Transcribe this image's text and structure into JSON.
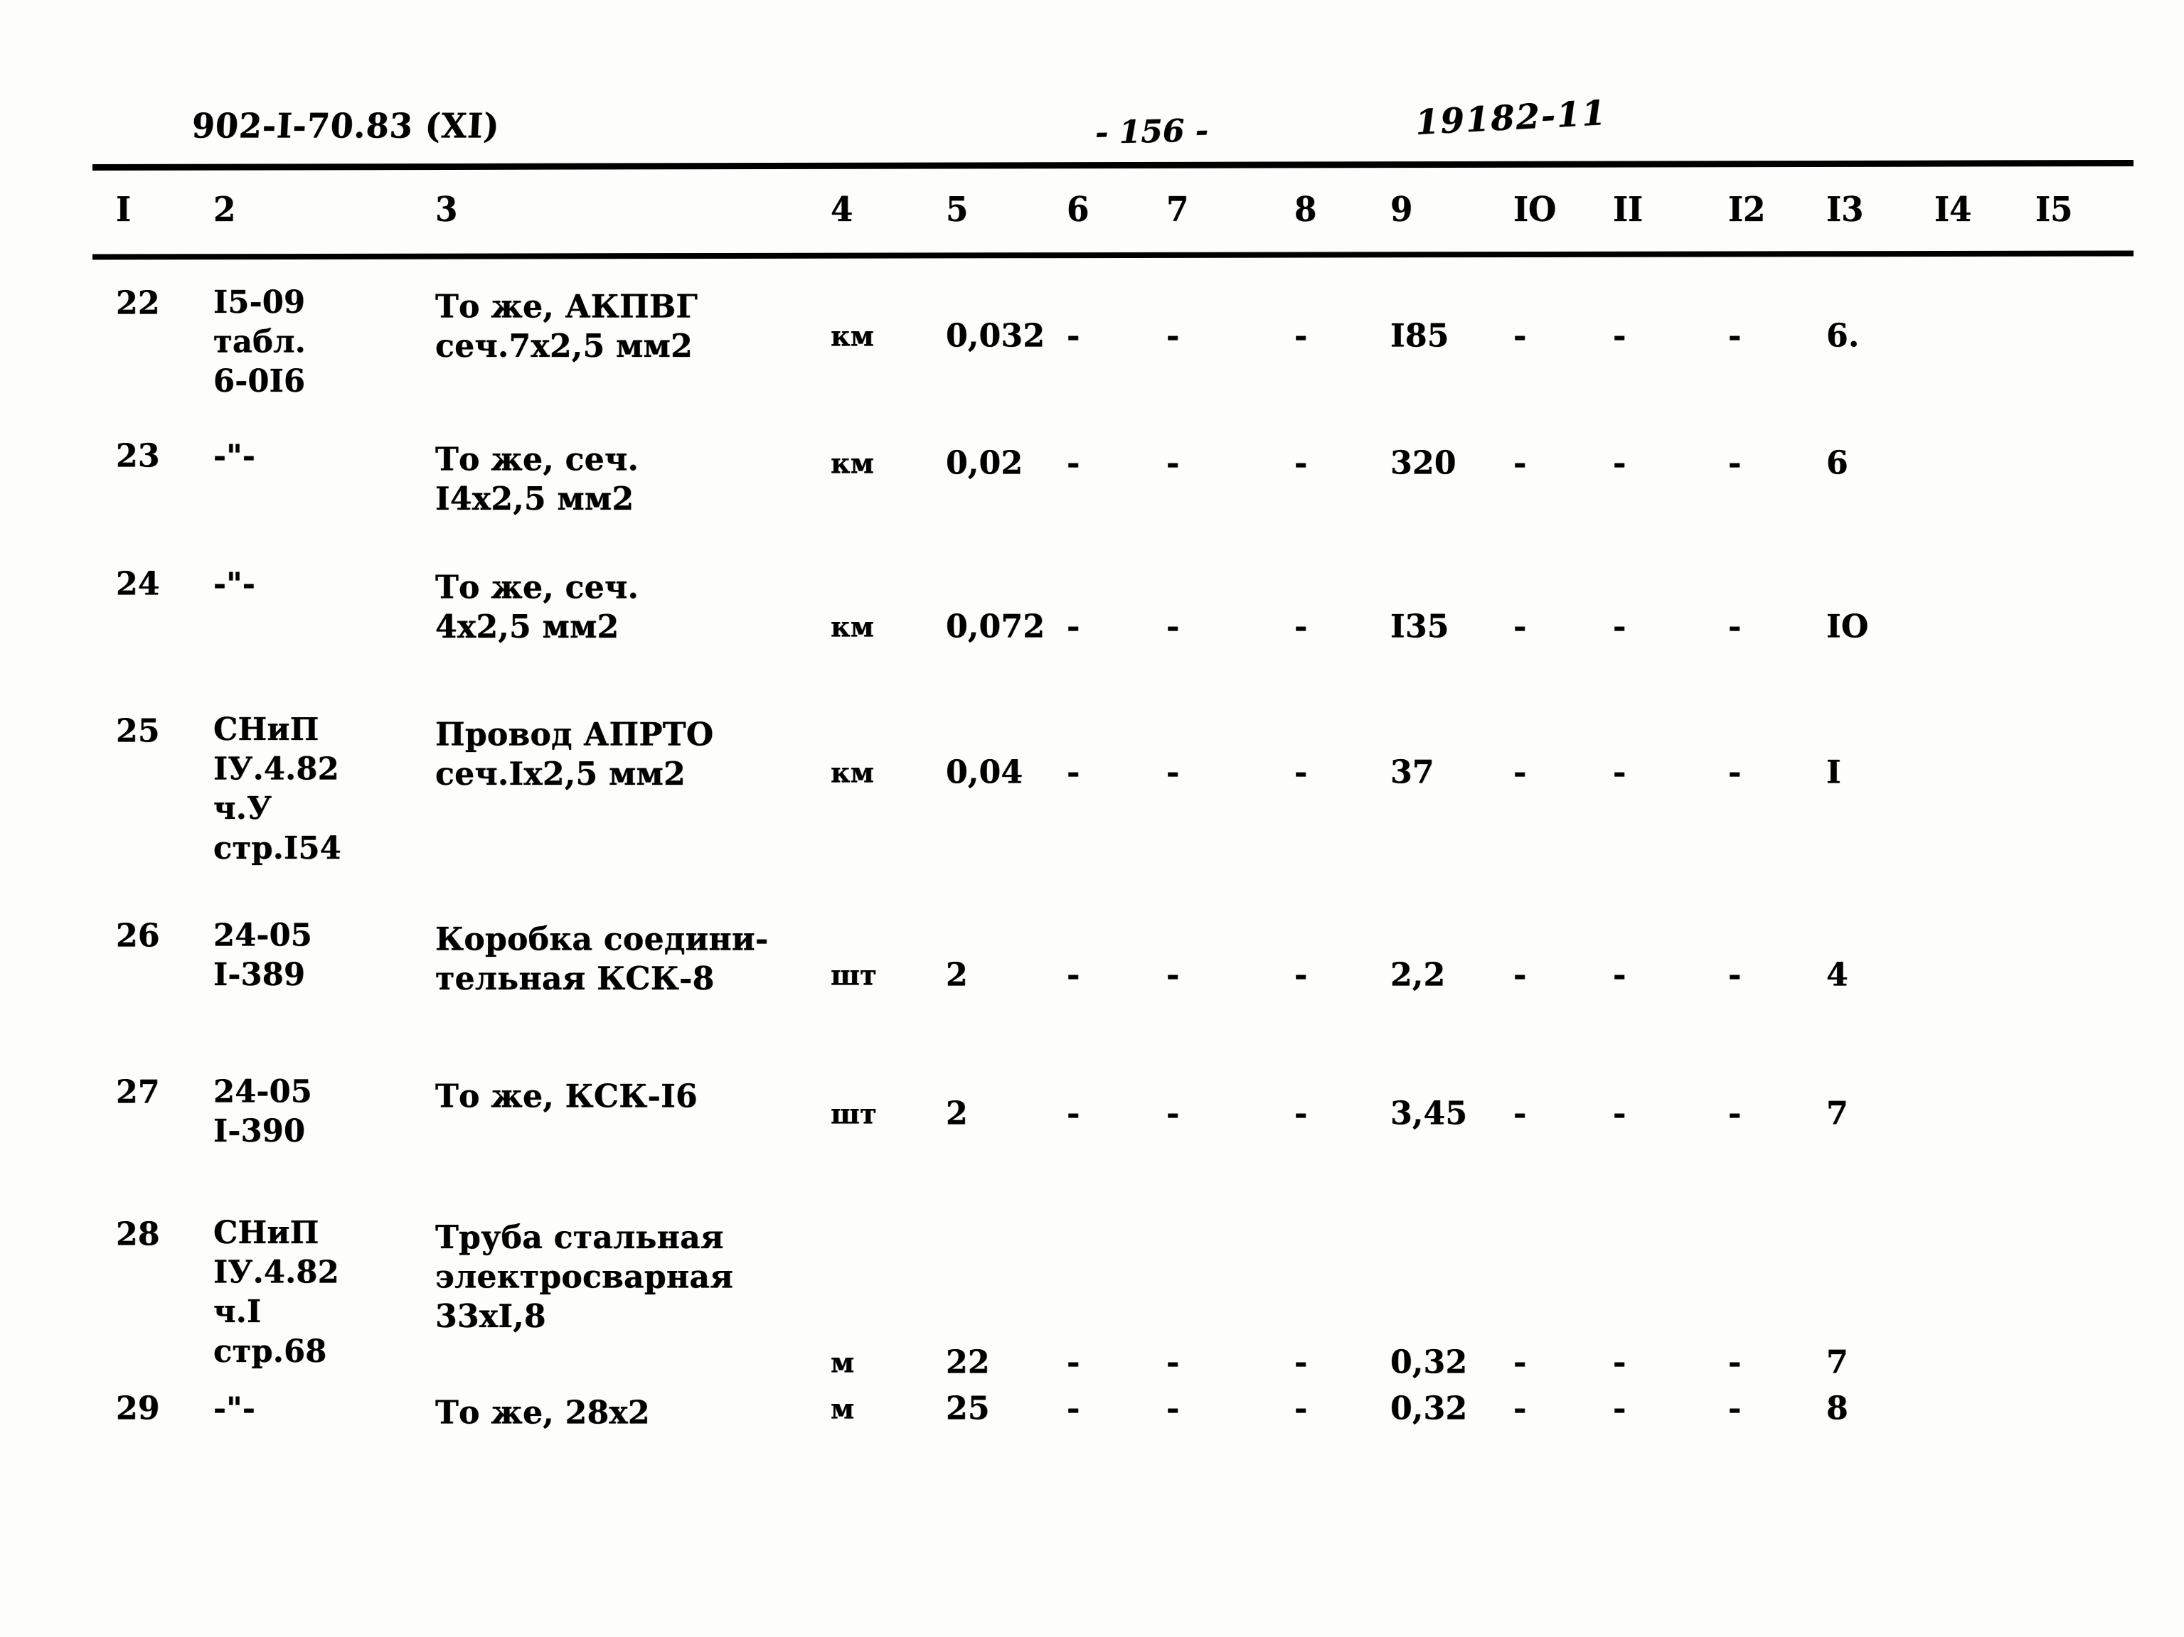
{
  "header": {
    "doc_code": "902-I-70.83  (XI)",
    "page_number": "- 156 -",
    "stamp_number": "19182-11"
  },
  "table": {
    "column_headers": [
      "I",
      "2",
      "3",
      "4",
      "5",
      "6",
      "7",
      "8",
      "9",
      "IO",
      "II",
      "I2",
      "I3",
      "I4",
      "I5"
    ],
    "rows": [
      {
        "c1": "22",
        "c2": "I5-09\nтабл.\n6-0I6",
        "c3": "То же, АКПВГ\nсеч.7х2,5 мм2",
        "c4": "км",
        "c5": "0,032",
        "c6": "-",
        "c7": "-",
        "c8": "-",
        "c9": "I85",
        "c10": "-",
        "c11": "-",
        "c12": "-",
        "c13": "6.",
        "c14": "",
        "c15": ""
      },
      {
        "c1": "23",
        "c2": "-\"-",
        "c3": "То же, сеч.\nI4х2,5 мм2",
        "c4": "км",
        "c5": "0,02",
        "c6": "-",
        "c7": "-",
        "c8": "-",
        "c9": "320",
        "c10": "-",
        "c11": "-",
        "c12": "-",
        "c13": "6",
        "c14": "",
        "c15": ""
      },
      {
        "c1": "24",
        "c2": "-\"-",
        "c3": "То же, сеч.\n4х2,5 мм2",
        "c4": "км",
        "c5": "0,072",
        "c6": "-",
        "c7": "-",
        "c8": "-",
        "c9": "I35",
        "c10": "-",
        "c11": "-",
        "c12": "-",
        "c13": "IO",
        "c14": "",
        "c15": ""
      },
      {
        "c1": "25",
        "c2": "СНиП\nIУ.4.82\nч.У\nстр.I54",
        "c3": "Провод АПРТО\nсеч.Iх2,5 мм2",
        "c4": "км",
        "c5": "0,04",
        "c6": "-",
        "c7": "-",
        "c8": "-",
        "c9": "37",
        "c10": "-",
        "c11": "-",
        "c12": "-",
        "c13": "I",
        "c14": "",
        "c15": ""
      },
      {
        "c1": "26",
        "c2": "24-05\nI-389",
        "c3": "Коробка соедини-\nтельная КСК-8",
        "c4": "шт",
        "c5": "2",
        "c6": "-",
        "c7": "-",
        "c8": "-",
        "c9": "2,2",
        "c10": "-",
        "c11": "-",
        "c12": "-",
        "c13": "4",
        "c14": "",
        "c15": ""
      },
      {
        "c1": "27",
        "c2": "24-05\nI-390",
        "c3": "То же, КСК-I6",
        "c4": "шт",
        "c5": "2",
        "c6": "-",
        "c7": "-",
        "c8": "-",
        "c9": "3,45",
        "c10": "-",
        "c11": "-",
        "c12": "-",
        "c13": "7",
        "c14": "",
        "c15": ""
      },
      {
        "c1": "28",
        "c2": "СНиП\nIУ.4.82\nч.I\nстр.68",
        "c3": "Труба стальная\nэлектросварная\n33хI,8",
        "c4": "м",
        "c5": "22",
        "c6": "-",
        "c7": "-",
        "c8": "-",
        "c9": "0,32",
        "c10": "-",
        "c11": "-",
        "c12": "-",
        "c13": "7",
        "c14": "",
        "c15": ""
      },
      {
        "c1": "29",
        "c2": "-\"-",
        "c3": "То же, 28х2",
        "c4": "м",
        "c5": "25",
        "c6": "-",
        "c7": "-",
        "c8": "-",
        "c9": "0,32",
        "c10": "-",
        "c11": "-",
        "c12": "-",
        "c13": "8",
        "c14": "",
        "c15": ""
      }
    ]
  }
}
